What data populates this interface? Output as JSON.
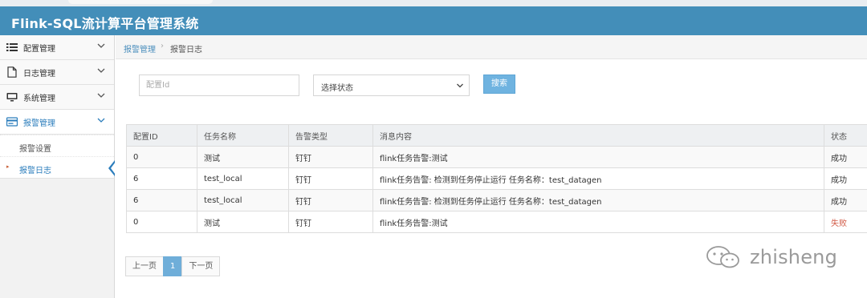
{
  "app": {
    "title": "Flink-SQL流计算平台管理系统"
  },
  "sidebar": {
    "items": [
      {
        "label": "配置管理",
        "icon": "list-icon"
      },
      {
        "label": "日志管理",
        "icon": "file-icon"
      },
      {
        "label": "系统管理",
        "icon": "monitor-icon"
      },
      {
        "label": "报警管理",
        "icon": "alarm-card-icon"
      }
    ],
    "subitems": [
      {
        "label": "报警设置"
      },
      {
        "label": "报警日志"
      }
    ]
  },
  "breadcrumb": {
    "parent": "报警管理",
    "separator": "›",
    "current": "报警日志"
  },
  "filters": {
    "config_id_placeholder": "配置Id",
    "status_select_value": "选择状态",
    "search_label": "搜索"
  },
  "table": {
    "headers": [
      "配置ID",
      "任务名称",
      "告警类型",
      "消息内容",
      "状态"
    ],
    "rows": [
      [
        "0",
        "测试",
        "钉钉",
        "flink任务告警:测试",
        "成功"
      ],
      [
        "6",
        "test_local",
        "钉钉",
        "flink任务告警: 检测到任务停止运行 任务名称：test_datagen",
        "成功"
      ],
      [
        "6",
        "test_local",
        "钉钉",
        "flink任务告警: 检测到任务停止运行 任务名称：test_datagen",
        "成功"
      ],
      [
        "0",
        "测试",
        "钉钉",
        "flink任务告警:测试",
        "失败"
      ]
    ]
  },
  "pagination": {
    "prev": "上一页",
    "current": "1",
    "next": "下一页"
  },
  "watermark": {
    "text": "zhisheng"
  },
  "colors": {
    "header": "#438eb9",
    "accent": "#2b7dbc",
    "fail": "#d15b47",
    "button": "#6fb3e0"
  }
}
